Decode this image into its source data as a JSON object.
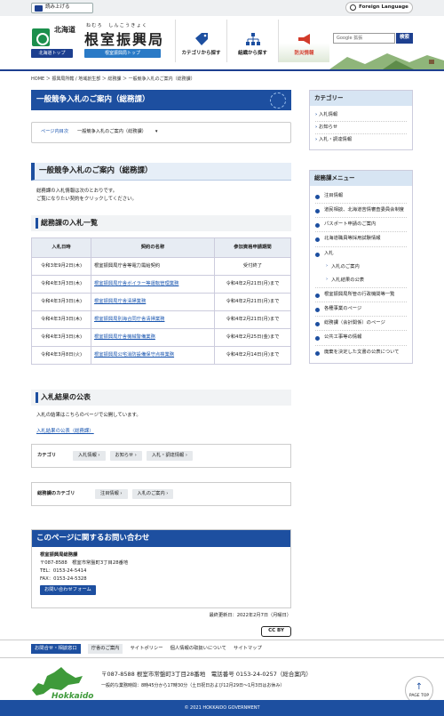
{
  "topbar": {
    "readaloud": "読み上げる",
    "foreign": "Foreign Language"
  },
  "header": {
    "prefecture": "北海道",
    "ruby": "ねむろ　しんこうきょく",
    "bureau": "根室振興局",
    "tag_home": "北海道トップ",
    "tag_top": "根室振興局トップ",
    "nav": [
      {
        "label": "カテゴリから探す"
      },
      {
        "label": "組織から探す"
      },
      {
        "label": "防災情報"
      }
    ],
    "search_placeholder": "Google 拡張",
    "search_btn": "検索"
  },
  "breadcrumb": "HOME  ＞  振興局所轄 / 地域創生部  ＞  総務課  ＞  一般競争入札のご案内（総務課）",
  "page_title": "一般競争入札のご案内（総務課）",
  "toc": {
    "label": "ページ内目次",
    "item": "一般競争入札のご案内（総務課）"
  },
  "h2": "一般競争入札のご案内（総務課）",
  "intro1": "総務課の入札情報は次のとおりです。",
  "intro2": "ご覧になりたい契約をクリックしてください。",
  "list_heading": "総務課の入札一覧",
  "table": {
    "headers": [
      "入札日時",
      "契約の名称",
      "参加資格申請期間"
    ],
    "rows": [
      [
        "令和3年9月2日(木)",
        "根室振興局庁舎等電力需給契約",
        "受付終了"
      ],
      [
        "令和4年3月3日(木)",
        "根室振興局庁舎ボイラー等運転管理業務",
        "令和4年2月21日(月)まで"
      ],
      [
        "令和4年3月3日(木)",
        "根室振興局庁舎清掃業務",
        "令和4年2月21日(月)まで"
      ],
      [
        "令和4年3月3日(木)",
        "根室振興局別海合同庁舎清掃業務",
        "令和4年2月21日(月)まで"
      ],
      [
        "令和4年3月3日(木)",
        "根室振興局庁舎機械警備業務",
        "令和4年2月25日(金)まで"
      ],
      [
        "令和4年3月8日(火)",
        "根室振興局公宅消防設備保守点検業務",
        "令和4年2月14日(月)まで"
      ]
    ]
  },
  "results_heading": "入札結果の公表",
  "results_text": "入札の結果はこちらのページで公開しています。",
  "results_link": "入札結果の公表（総務課）",
  "category": {
    "label": "カテゴリ",
    "tags": [
      "入札情報",
      "お知らせ",
      "入札・調達情報"
    ]
  },
  "dept_category": {
    "label": "総務課のカテゴリ",
    "tags": [
      "注目情報",
      "入札のご案内"
    ]
  },
  "contact": {
    "heading": "このページに関するお問い合わせ",
    "org": "根室振興局総務課",
    "addr": "〒087-8588　根室市常盤町3丁目28番地",
    "tel": "TEL：0153-24-5414",
    "fax": "FAX：0153-24-5328",
    "form": "お問い合わせフォーム"
  },
  "updated": "最終更新日：2022年2月7日（月曜日）",
  "cc": "CC BY",
  "sidebar": {
    "cat_head": "カテゴリー",
    "cats": [
      "入札情報",
      "お知らせ",
      "入札・調達情報"
    ],
    "menu_head": "総務課メニュー",
    "menu": [
      {
        "label": "注目情報",
        "sub": false
      },
      {
        "label": "道民相談、北海道苦情審査委員会制度",
        "sub": false
      },
      {
        "label": "パスポート申請のご案内",
        "sub": false
      },
      {
        "label": "北海道職員等採用試験情報",
        "sub": false
      },
      {
        "label": "入札",
        "sub": false
      },
      {
        "label": "入札のご案内",
        "sub": true
      },
      {
        "label": "入札結果の公表",
        "sub": true
      },
      {
        "label": "根室振興局所管の行政機関等一覧",
        "sub": false
      },
      {
        "label": "各種事業のページ",
        "sub": false
      },
      {
        "label": "総務課（会計関係）のページ",
        "sub": false
      },
      {
        "label": "公共工事等の情報",
        "sub": false
      },
      {
        "label": "廃棄を決定した文書の公表について",
        "sub": false
      }
    ]
  },
  "footer": {
    "contact_btn": "お問合せ・相談窓口",
    "office_btn": "庁舎のご案内",
    "links": [
      "サイトポリシー",
      "個人情報の取扱いについて",
      "サイトマップ"
    ],
    "logo": "Hokkaido",
    "address": "〒087-8588 根室市常盤町3丁目28番地　電話番号 0153-24-0257（総合案内）",
    "hours": "一般的な業務時間：8時45分から17時30分（土日祝日および12月29日～1月3日はお休み）",
    "pagetop": "PAGE TOP",
    "copyright": "© 2021 HOKKAIDO GOVERNMENT"
  },
  "colors": {
    "primary": "#1d4fa0",
    "accent": "#2a7ac6"
  }
}
